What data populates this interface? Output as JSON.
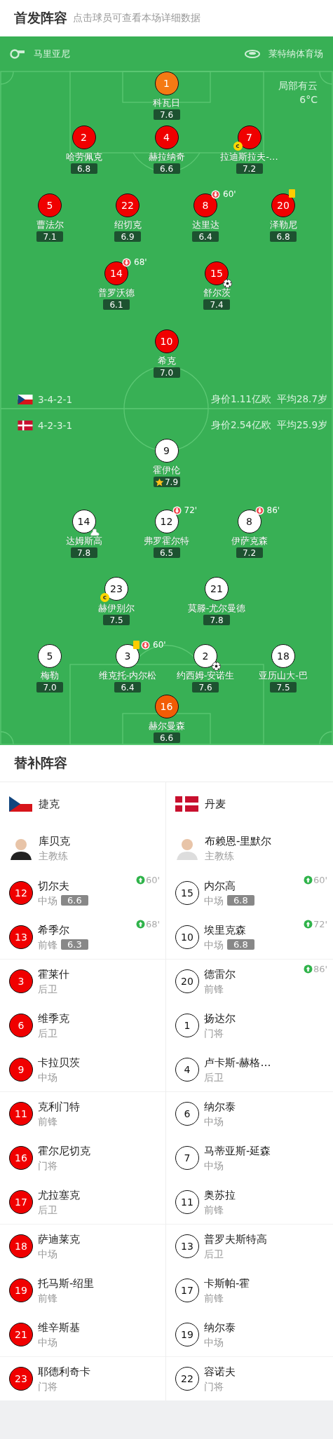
{
  "lineup": {
    "title": "首发阵容",
    "subtitle": "点击球员可查看本场详细数据",
    "referee": "马里亚尼",
    "stadium": "莱特纳体育场",
    "weather": "局部有云",
    "temperature": "6°C",
    "teams": [
      {
        "kind": "home",
        "flag": {
          "kind": "czech"
        },
        "formation": "3-4-2-1",
        "value": "身价1.11亿欧",
        "average_age": "平均28.7岁",
        "rows": [
          [
            {
              "kind": "goalkeeper",
              "number": "1",
              "name": "科瓦日",
              "rating": "7.6"
            }
          ],
          [
            {
              "kind": "outfield",
              "number": "2",
              "name": "哈劳佩克",
              "rating": "6.8"
            },
            {
              "kind": "outfield",
              "number": "4",
              "name": "赫拉纳奇",
              "rating": "6.6"
            },
            {
              "kind": "outfield",
              "number": "7",
              "name": "拉迪斯拉夫-…",
              "rating": "7.2",
              "events": [
                {
                  "kind": "captain",
                  "label": "c"
                }
              ]
            }
          ],
          [
            {
              "kind": "outfield",
              "number": "5",
              "name": "曹法尔",
              "rating": "7.1"
            },
            {
              "kind": "outfield",
              "number": "22",
              "name": "绍切克",
              "rating": "6.9"
            },
            {
              "kind": "outfield",
              "number": "8",
              "name": "达里达",
              "rating": "6.4",
              "events": [
                {
                  "kind": "sub_off",
                  "minute": "60'"
                }
              ]
            },
            {
              "kind": "outfield",
              "number": "20",
              "name": "泽勒尼",
              "rating": "6.8",
              "events": [
                {
                  "kind": "yellow_card"
                }
              ]
            }
          ],
          [
            {
              "kind": "outfield",
              "number": "14",
              "name": "普罗沃德",
              "rating": "6.1",
              "events": [
                {
                  "kind": "sub_off",
                  "minute": "68'"
                }
              ]
            },
            {
              "kind": "outfield",
              "number": "15",
              "name": "舒尔茨",
              "rating": "7.4",
              "events": [
                {
                  "kind": "goal"
                }
              ]
            }
          ],
          [
            {
              "kind": "outfield",
              "number": "10",
              "name": "希克",
              "rating": "7.0"
            }
          ]
        ]
      },
      {
        "kind": "away",
        "flag": {
          "kind": "denmark"
        },
        "formation": "4-2-3-1",
        "value": "身价2.54亿欧",
        "average_age": "平均25.9岁",
        "rows": [
          [
            {
              "kind": "outfield",
              "number": "9",
              "name": "霍伊伦",
              "rating": "7.9",
              "best": true
            }
          ],
          [
            {
              "kind": "outfield",
              "number": "14",
              "name": "达姆斯高",
              "rating": "7.8",
              "events": [
                {
                  "kind": "assist"
                }
              ]
            },
            {
              "kind": "outfield",
              "number": "12",
              "name": "弗罗霍尔特",
              "rating": "6.5",
              "events": [
                {
                  "kind": "sub_off",
                  "minute": "72'"
                }
              ]
            },
            {
              "kind": "outfield",
              "number": "8",
              "name": "伊萨克森",
              "rating": "7.2",
              "events": [
                {
                  "kind": "sub_off",
                  "minute": "86'"
                }
              ]
            }
          ],
          [
            {
              "kind": "outfield",
              "number": "23",
              "name": "赫伊别尔",
              "rating": "7.5",
              "events": [
                {
                  "kind": "captain",
                  "label": "c"
                }
              ]
            },
            {
              "kind": "outfield",
              "number": "21",
              "name": "莫滕-尤尔曼德",
              "rating": "7.8"
            }
          ],
          [
            {
              "kind": "outfield",
              "number": "5",
              "name": "梅勒",
              "rating": "7.0"
            },
            {
              "kind": "outfield",
              "number": "3",
              "name": "维克托-内尔松",
              "rating": "6.4",
              "events": [
                {
                  "kind": "yellow_card"
                },
                {
                  "kind": "sub_off",
                  "minute": "60'"
                }
              ]
            },
            {
              "kind": "outfield",
              "number": "2",
              "name": "约西姆-安诺生",
              "rating": "7.6",
              "events": [
                {
                  "kind": "goal"
                }
              ]
            },
            {
              "kind": "outfield",
              "number": "18",
              "name": "亚历山大-巴",
              "rating": "7.5"
            }
          ],
          [
            {
              "kind": "goalkeeper",
              "number": "16",
              "name": "赫尔曼森",
              "rating": "6.6"
            }
          ]
        ]
      }
    ]
  },
  "bench": {
    "title": "替补阵容",
    "teams": [
      {
        "kind": "home",
        "flag": {
          "kind": "czech"
        },
        "name": "捷克",
        "coach": {
          "name": "库贝克",
          "role": "主教练"
        },
        "players": [
          {
            "number": "12",
            "name": "切尔夫",
            "position": "中场",
            "rating": "6.6",
            "sub_in": "60'"
          },
          {
            "number": "13",
            "name": "希季尔",
            "position": "前锋",
            "rating": "6.3",
            "sub_in": "68'"
          },
          {
            "number": "3",
            "name": "霍莱什",
            "position": "后卫"
          },
          {
            "number": "6",
            "name": "维季克",
            "position": "后卫"
          },
          {
            "number": "9",
            "name": "卡拉贝茨",
            "position": "中场"
          },
          {
            "number": "11",
            "name": "克利门特",
            "position": "前锋"
          },
          {
            "number": "16",
            "name": "霍尔尼切克",
            "position": "门将"
          },
          {
            "number": "17",
            "name": "尤拉塞克",
            "position": "后卫"
          },
          {
            "number": "18",
            "name": "萨迪莱克",
            "position": "中场"
          },
          {
            "number": "19",
            "name": "托马斯-绍里",
            "position": "前锋"
          },
          {
            "number": "21",
            "name": "维辛斯基",
            "position": "中场"
          },
          {
            "number": "23",
            "name": "耶德利奇卡",
            "position": "门将"
          }
        ]
      },
      {
        "kind": "away",
        "flag": {
          "kind": "denmark"
        },
        "name": "丹麦",
        "coach": {
          "name": "布赖恩-里默尔",
          "role": "主教练"
        },
        "players": [
          {
            "number": "15",
            "name": "内尔高",
            "position": "中场",
            "rating": "6.8",
            "sub_in": "60'"
          },
          {
            "number": "10",
            "name": "埃里克森",
            "position": "中场",
            "rating": "6.8",
            "sub_in": "72'"
          },
          {
            "number": "20",
            "name": "德雷尔",
            "position": "前锋",
            "sub_in": "86'"
          },
          {
            "number": "1",
            "name": "扬达尔",
            "position": "门将"
          },
          {
            "number": "4",
            "name": "卢卡斯-赫格…",
            "position": "后卫"
          },
          {
            "number": "6",
            "name": "纳尔泰",
            "position": "中场"
          },
          {
            "number": "7",
            "name": "马蒂亚斯-延森",
            "position": "中场"
          },
          {
            "number": "11",
            "name": "奥苏拉",
            "position": "前锋"
          },
          {
            "number": "13",
            "name": "普罗夫斯特高",
            "position": "后卫"
          },
          {
            "number": "17",
            "name": "卡斯帕-霍",
            "position": "前锋"
          },
          {
            "number": "19",
            "name": "纳尔泰",
            "position": "中场"
          },
          {
            "number": "22",
            "name": "容诺夫",
            "position": "门将"
          }
        ]
      }
    ]
  }
}
